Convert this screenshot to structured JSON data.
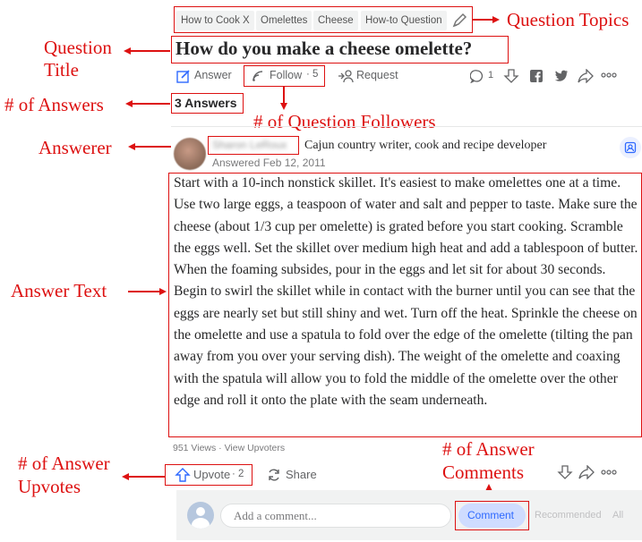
{
  "topics": [
    "How to Cook X",
    "Omelettes",
    "Cheese",
    "How-to Question"
  ],
  "question": {
    "title": "How do you make a cheese omelette?"
  },
  "question_actions": {
    "answer": "Answer",
    "follow": "Follow",
    "follow_count": "· 5",
    "request": "Request",
    "comment_count": "1"
  },
  "answers_count": "3 Answers",
  "answerer": {
    "name": "Sharon LeRoux",
    "bio": "Cajun country writer, cook and recipe developer",
    "date": "Answered Feb 12, 2011"
  },
  "answer": {
    "text": "Start with a 10-inch nonstick skillet. It's easiest to make omelettes one at a time. Use two large eggs, a teaspoon of water and salt and pepper to taste. Make sure the cheese (about 1/3 cup per omelette) is grated before you start cooking. Scramble the eggs well. Set the skillet over medium high heat and add a tablespoon of butter. When the foaming subsides, pour in the eggs and let sit for about 30 seconds. Begin to swirl the skillet while in contact with the burner until you can see that the eggs are nearly set but still shiny and wet. Turn off the heat. Sprinkle the cheese on the omelette and use a spatula to fold over the edge of the omelette (tilting the pan away from you over your serving dish). The weight of the omelette and coaxing with the spatula will allow you to fold the middle of the omelette over the other edge and roll it onto the plate with the seam underneath.",
    "views": "951 Views · View Upvoters",
    "upvote": "Upvote",
    "upvote_count": "· 2",
    "share": "Share"
  },
  "comment": {
    "placeholder": "Add a comment...",
    "button": "Comment",
    "recommended": "Recommended",
    "all": "All"
  },
  "annotations": {
    "question_topics": "Question Topics",
    "question_title_1": "Question",
    "question_title_2": "Title",
    "num_answers": "# of Answers",
    "num_followers": "# of Question Followers",
    "answerer": "Answerer",
    "answer_text": "Answer Text",
    "num_comments_1": "# of Answer",
    "num_comments_2": "Comments",
    "num_upvotes_1": "# of Answer",
    "num_upvotes_2": "Upvotes"
  },
  "colors": {
    "annotation": "#dd1111",
    "link_blue": "#2e69ff",
    "text": "#282829",
    "muted": "#636466"
  }
}
